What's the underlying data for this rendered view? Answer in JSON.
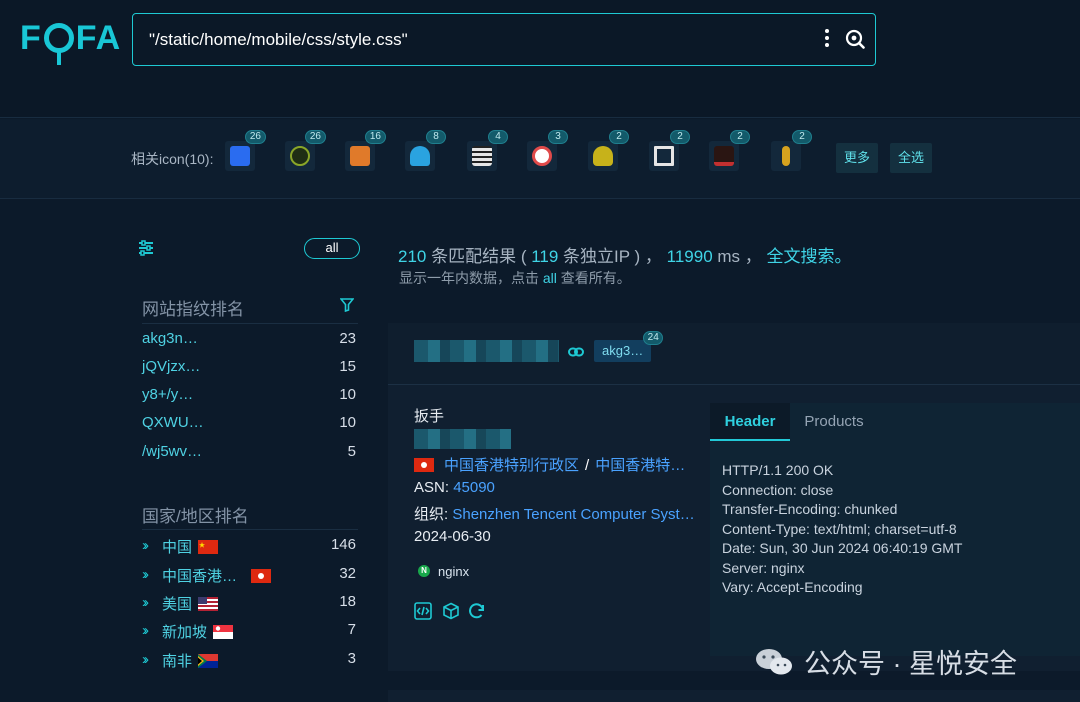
{
  "header": {
    "logo_text": "FOFA",
    "search_query": "\"/static/home/mobile/css/style.css\""
  },
  "related_icons": {
    "label": "相关icon(10):",
    "items": [
      {
        "icon": "favicon-blue-app",
        "count": "26",
        "color": "#2a6cf0"
      },
      {
        "icon": "favicon-green-leaf",
        "count": "26",
        "color": "#6b8a1e"
      },
      {
        "icon": "favicon-orange-c",
        "count": "16",
        "color": "#e07a2a"
      },
      {
        "icon": "favicon-cloud",
        "count": "8",
        "color": "#2aa3e0"
      },
      {
        "icon": "favicon-qr-seal",
        "count": "4",
        "color": "#d8d8d8"
      },
      {
        "icon": "favicon-chart-circle",
        "count": "3",
        "color": "#e04a4a"
      },
      {
        "icon": "favicon-palm-leaf",
        "count": "2",
        "color": "#c7b21a"
      },
      {
        "icon": "favicon-brackets",
        "count": "2",
        "color": "#e6e6e6"
      },
      {
        "icon": "favicon-red-text-logo",
        "count": "2",
        "color": "#c23030"
      },
      {
        "icon": "favicon-wheat",
        "count": "2",
        "color": "#d6a21e"
      }
    ],
    "more_label": "更多",
    "select_all_label": "全选"
  },
  "sidebar": {
    "all_label": "all",
    "fingerprint": {
      "title": "网站指纹排名",
      "items": [
        {
          "name": "akg3n…",
          "value": "23"
        },
        {
          "name": "jQVjzx…",
          "value": "15"
        },
        {
          "name": "y8+/y…",
          "value": "10"
        },
        {
          "name": "QXWU…",
          "value": "10"
        },
        {
          "name": "/wj5wv…",
          "value": "5"
        }
      ]
    },
    "country": {
      "title": "国家/地区排名",
      "items": [
        {
          "name": "中国",
          "value": "146",
          "flag": "cn"
        },
        {
          "name": "中国香港…",
          "value": "32",
          "flag": "hk"
        },
        {
          "name": "美国",
          "value": "18",
          "flag": "us"
        },
        {
          "name": "新加坡",
          "value": "7",
          "flag": "sg"
        },
        {
          "name": "南非",
          "value": "3",
          "flag": "za"
        }
      ]
    }
  },
  "summary": {
    "count": "210",
    "count_suffix": " 条匹配结果 ( ",
    "unique_ip": "119",
    "ip_suffix": " 条独立IP ) ， ",
    "time": "11990",
    "time_suffix": " ms ， ",
    "fulltext_link": "全文搜索。",
    "note_prefix": "显示一年内数据，点击 ",
    "note_all": "all",
    "note_suffix": " 查看所有。"
  },
  "result": {
    "tag": "akg3…",
    "tag_count": "24",
    "title": "扳手",
    "location_1": "中国香港特别行政区",
    "location_sep": "/",
    "location_2": "中国香港特…",
    "asn_label": "ASN: ",
    "asn_value": "45090",
    "org_label": "组织: ",
    "org_value": "Shenzhen Tencent Computer Syst…",
    "date": "2024-06-30",
    "server_tag": "nginx",
    "tabs": {
      "header": "Header",
      "products": "Products"
    },
    "http_header_lines": [
      "HTTP/1.1 200 OK",
      "Connection: close",
      "Transfer-Encoding: chunked",
      "Content-Type: text/html; charset=utf-8",
      "Date: Sun, 30 Jun 2024 06:40:19 GMT",
      "Server: nginx",
      "Vary: Accept-Encoding"
    ]
  },
  "watermark": "公众号 · 星悦安全",
  "colors": {
    "accent": "#1ec9d3",
    "link": "#4aa2ff",
    "background": "#0c1a2a"
  }
}
